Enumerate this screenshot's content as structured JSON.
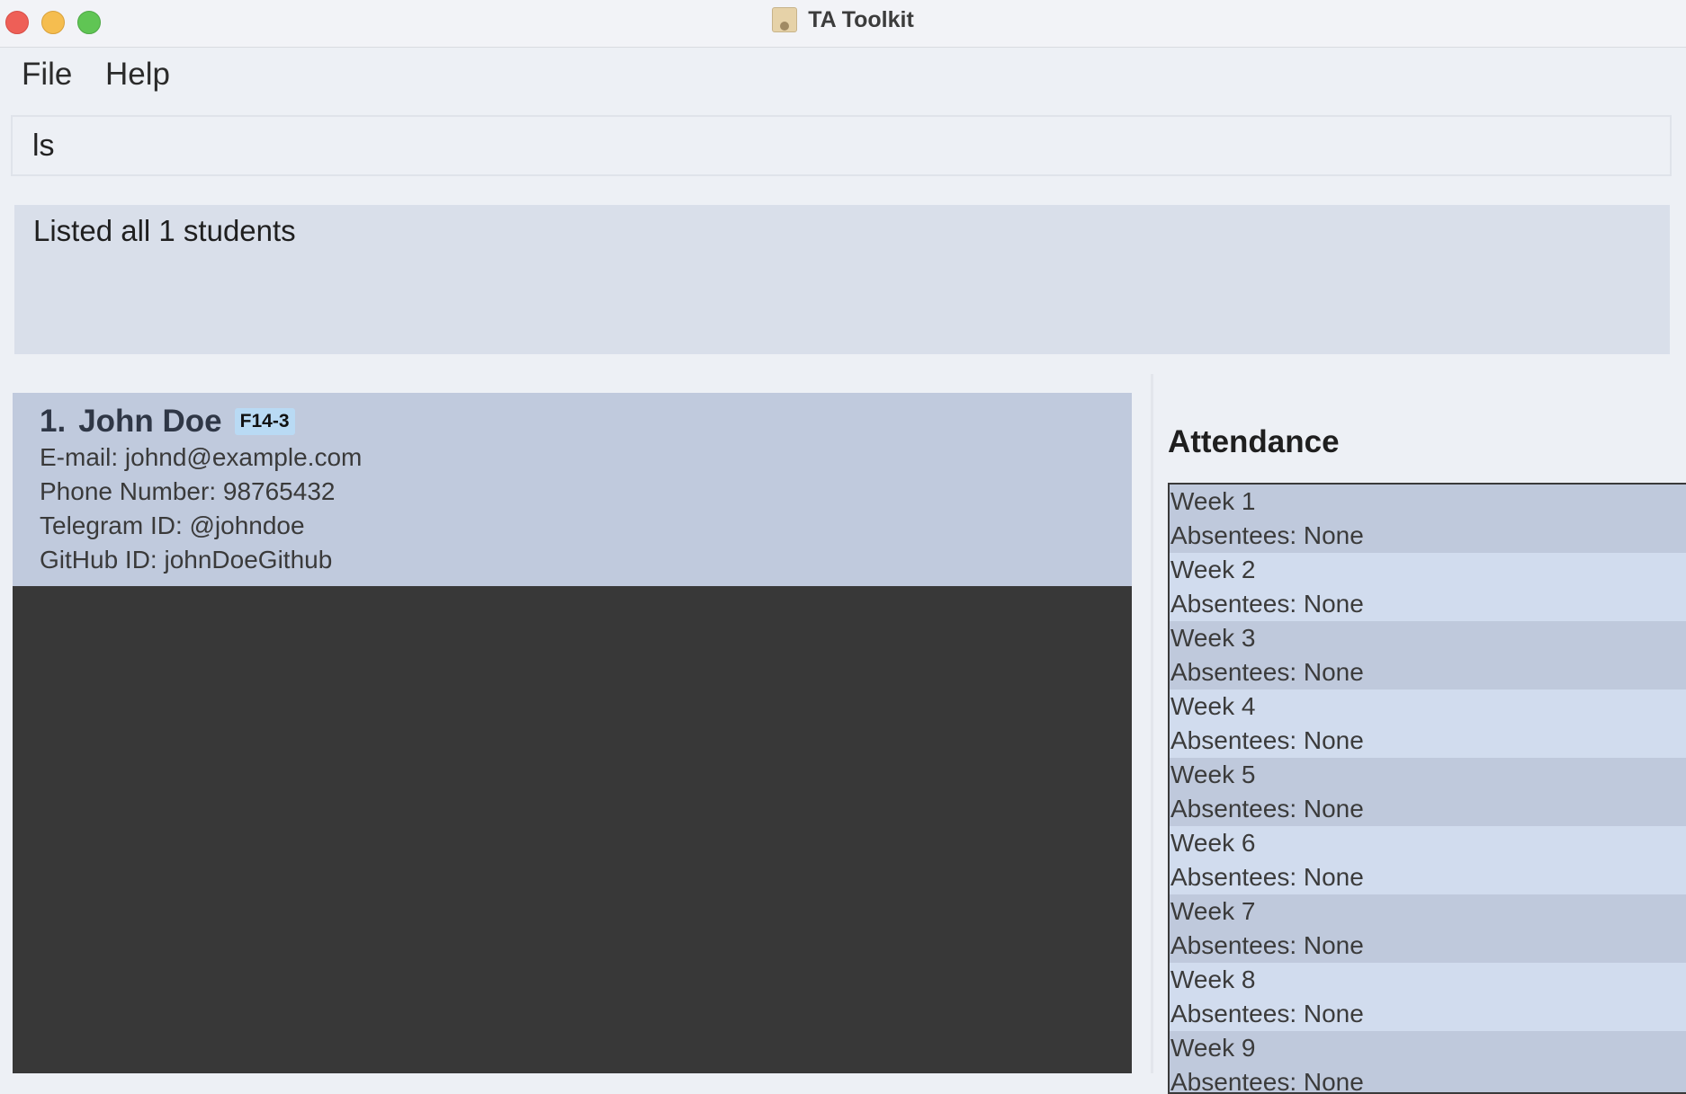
{
  "window": {
    "title": "TA Toolkit"
  },
  "menu": {
    "items": [
      "File",
      "Help"
    ]
  },
  "command": {
    "value": "ls"
  },
  "result": {
    "text": "Listed all 1 students"
  },
  "students": [
    {
      "index": "1.",
      "name": "John Doe",
      "tag": "F14-3",
      "email": "E-mail: johnd@example.com",
      "phone": "Phone Number: 98765432",
      "telegram": "Telegram ID: @johndoe",
      "github": "GitHub ID: johnDoeGithub"
    }
  ],
  "attendance": {
    "title": "Attendance",
    "weeks": [
      {
        "week": "Week 1",
        "absentees": "Absentees: None"
      },
      {
        "week": "Week 2",
        "absentees": "Absentees: None"
      },
      {
        "week": "Week 3",
        "absentees": "Absentees: None"
      },
      {
        "week": "Week 4",
        "absentees": "Absentees: None"
      },
      {
        "week": "Week 5",
        "absentees": "Absentees: None"
      },
      {
        "week": "Week 6",
        "absentees": "Absentees: None"
      },
      {
        "week": "Week 7",
        "absentees": "Absentees: None"
      },
      {
        "week": "Week 8",
        "absentees": "Absentees: None"
      },
      {
        "week": "Week 9",
        "absentees": "Absentees: None"
      }
    ]
  }
}
